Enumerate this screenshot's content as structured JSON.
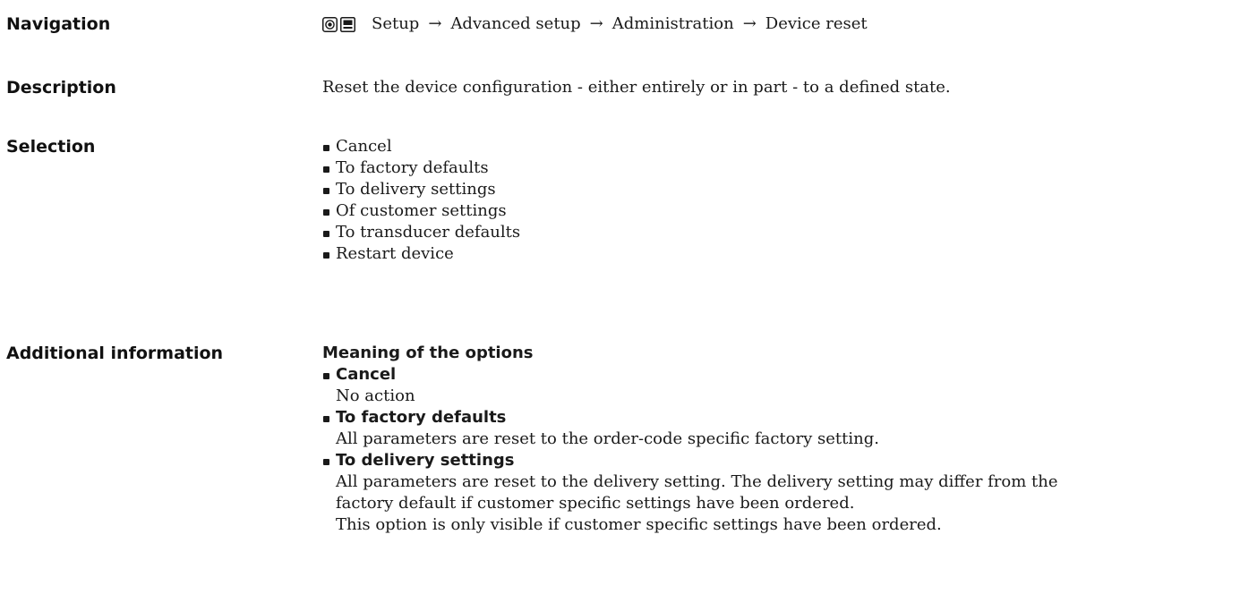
{
  "navigation": {
    "label": "Navigation",
    "icons": [
      "expert-menu-icon",
      "display-icon"
    ],
    "path": [
      "Setup",
      "Advanced setup",
      "Administration",
      "Device reset"
    ],
    "separator": "→"
  },
  "description": {
    "label": "Description",
    "text": "Reset the device configuration - either entirely or in part - to a defined state."
  },
  "selection": {
    "label": "Selection",
    "items": [
      "Cancel",
      "To factory defaults",
      "To delivery settings",
      "Of customer settings",
      "To transducer defaults",
      "Restart device"
    ]
  },
  "additional": {
    "label": "Additional information",
    "heading": "Meaning of the options",
    "options": [
      {
        "name": "Cancel",
        "lines": [
          "No action"
        ]
      },
      {
        "name": "To factory defaults",
        "lines": [
          "All parameters are reset to the order-code specific factory setting."
        ]
      },
      {
        "name": "To delivery settings",
        "lines": [
          "All parameters are reset to the delivery setting. The delivery setting may differ from the",
          "factory default if customer specific settings have been ordered.",
          "This option is only visible if customer specific settings have been ordered."
        ]
      }
    ]
  }
}
